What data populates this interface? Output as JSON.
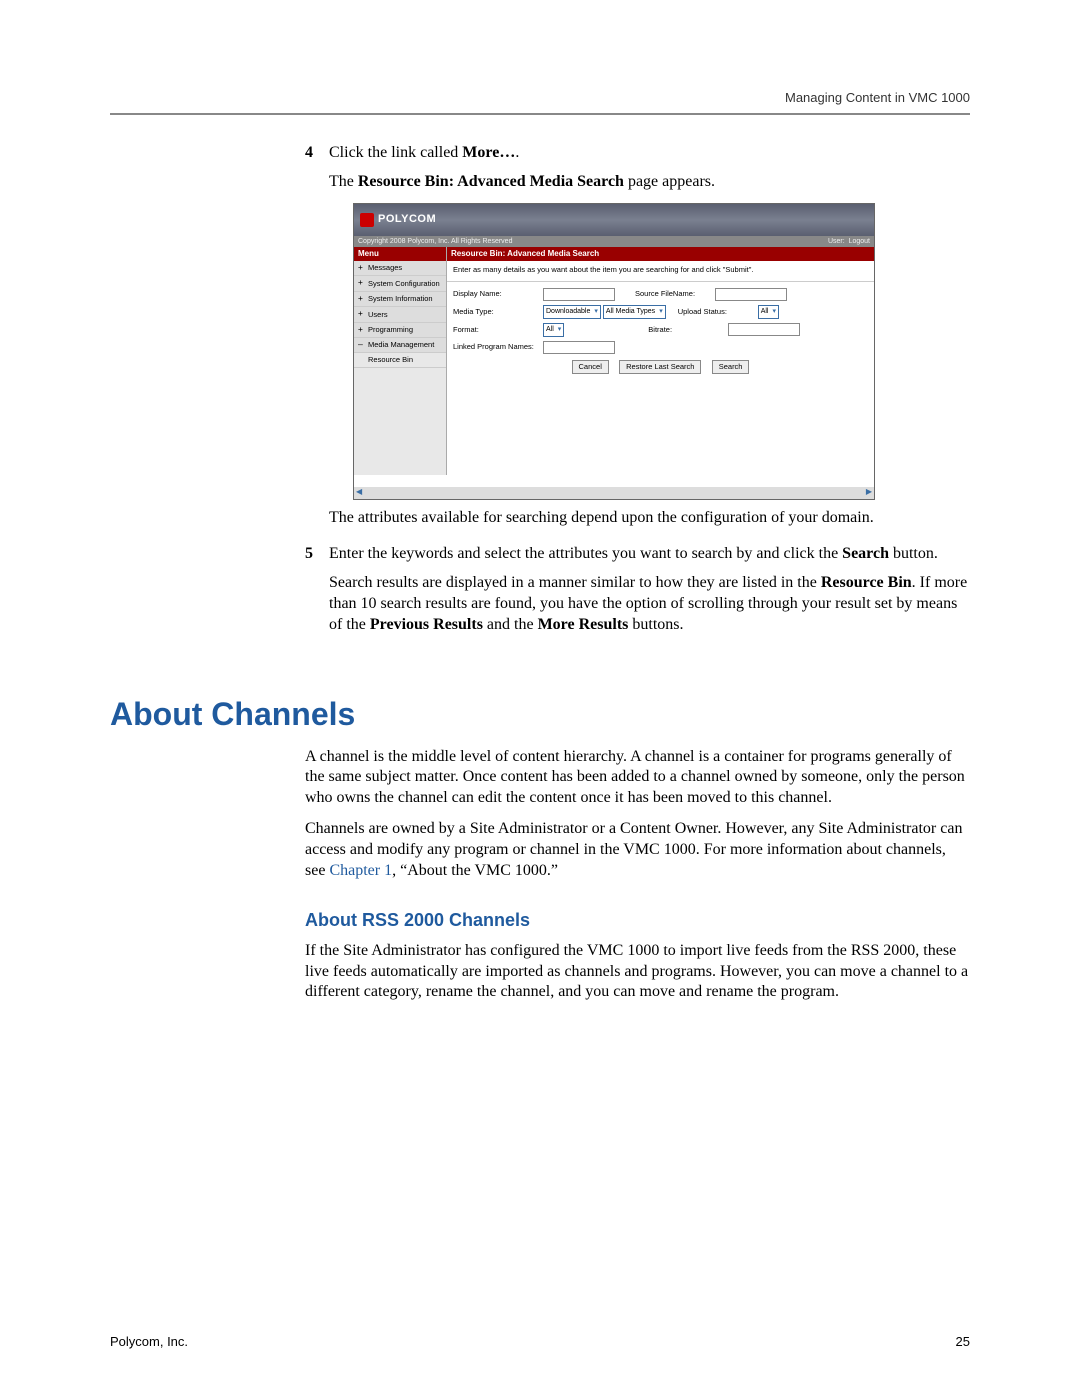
{
  "header": {
    "right": "Managing Content in VMC 1000"
  },
  "steps": {
    "s4": {
      "num": "4",
      "text_a": "Click the link called ",
      "bold_a": "More…",
      "text_b": ".",
      "line2_a": "The ",
      "line2_bold": "Resource Bin: Advanced Media Search",
      "line2_b": " page appears."
    },
    "after_ss": "The attributes available for searching depend upon the configuration of your domain.",
    "s5": {
      "num": "5",
      "text_a": "Enter the keywords and select the attributes you want to search by and click the ",
      "bold_a": "Search",
      "text_b": " button."
    },
    "s5_para2_a": "Search results are displayed in a manner similar to how they are listed in the ",
    "s5_para2_b1": "Resource Bin",
    "s5_para2_c": ". If more than 10 search results are found, you have the option of scrolling through your result set by means of the ",
    "s5_para2_b2": "Previous Results",
    "s5_para2_d": " and the ",
    "s5_para2_b3": "More Results",
    "s5_para2_e": " buttons."
  },
  "screenshot": {
    "logo": "POLYCOM",
    "copyright": "Copyright 2008 Polycom, Inc. All Rights Reserved",
    "user_label": "User:",
    "logout": "Logout",
    "menu_header": "Menu",
    "menu": [
      "Messages",
      "System Configuration",
      "System Information",
      "Users",
      "Programming",
      "Media Management",
      "Resource Bin"
    ],
    "title": "Resource Bin: Advanced Media Search",
    "instruction": "Enter as many details as you want about the item you are searching for and click \"Submit\".",
    "labels": {
      "display_name": "Display Name:",
      "source_filename": "Source FileName:",
      "media_type": "Media Type:",
      "upload_status": "Upload Status:",
      "format": "Format:",
      "bitrate": "Bitrate:",
      "linked": "Linked Program Names:"
    },
    "selects": {
      "downloadable": "Downloadable",
      "all_media": "All Media Types",
      "all": "All",
      "all2": "All"
    },
    "buttons": {
      "cancel": "Cancel",
      "restore": "Restore Last Search",
      "search": "Search"
    }
  },
  "heading1": "About Channels",
  "p1": "A channel is the middle level of content hierarchy. A channel is a container for programs generally of the same subject matter. Once content has been added to a channel owned by someone, only the person who owns the channel can edit the content once it has been moved to this channel.",
  "p2_a": "Channels are owned by a Site Administrator or a Content Owner. However, any Site Administrator can access and modify any program or channel in the VMC 1000. For more information about channels, see ",
  "p2_link": "Chapter 1",
  "p2_b": ", “About the VMC 1000.”",
  "heading2": "About RSS 2000 Channels",
  "p3": "If the Site Administrator has configured the VMC 1000 to import live feeds from the RSS 2000, these live feeds automatically are imported as channels and programs. However, you can move a channel to a different category, rename the channel, and you can move and rename the program.",
  "footer": {
    "left": "Polycom, Inc.",
    "right": "25"
  }
}
